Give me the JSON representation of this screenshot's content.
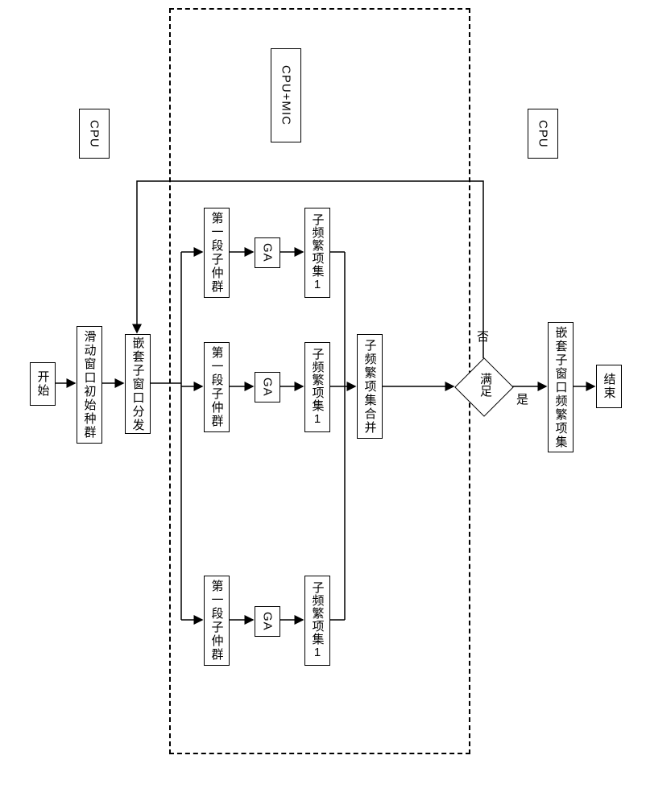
{
  "nodes": {
    "start": "开始",
    "init_pop": "滑动窗口初始种群",
    "dispatch": "嵌套子窗口分发",
    "subpop1": "第一段子仲群",
    "subpop2": "第一段子仲群",
    "subpop3": "第一段子仲群",
    "ga1": "GA",
    "ga2": "GA",
    "ga3": "GA",
    "subfreq1": "子频繁项集1",
    "subfreq2": "子频繁项集1",
    "subfreq3": "子频繁项集1",
    "merge": "子频繁项集合并",
    "decision": "满足",
    "nested_result": "嵌套子窗口频繁项集",
    "end": "结束"
  },
  "labels": {
    "cpu": "CPU",
    "cpu_mic": "CPU+MIC",
    "yes": "是",
    "no": "否"
  }
}
